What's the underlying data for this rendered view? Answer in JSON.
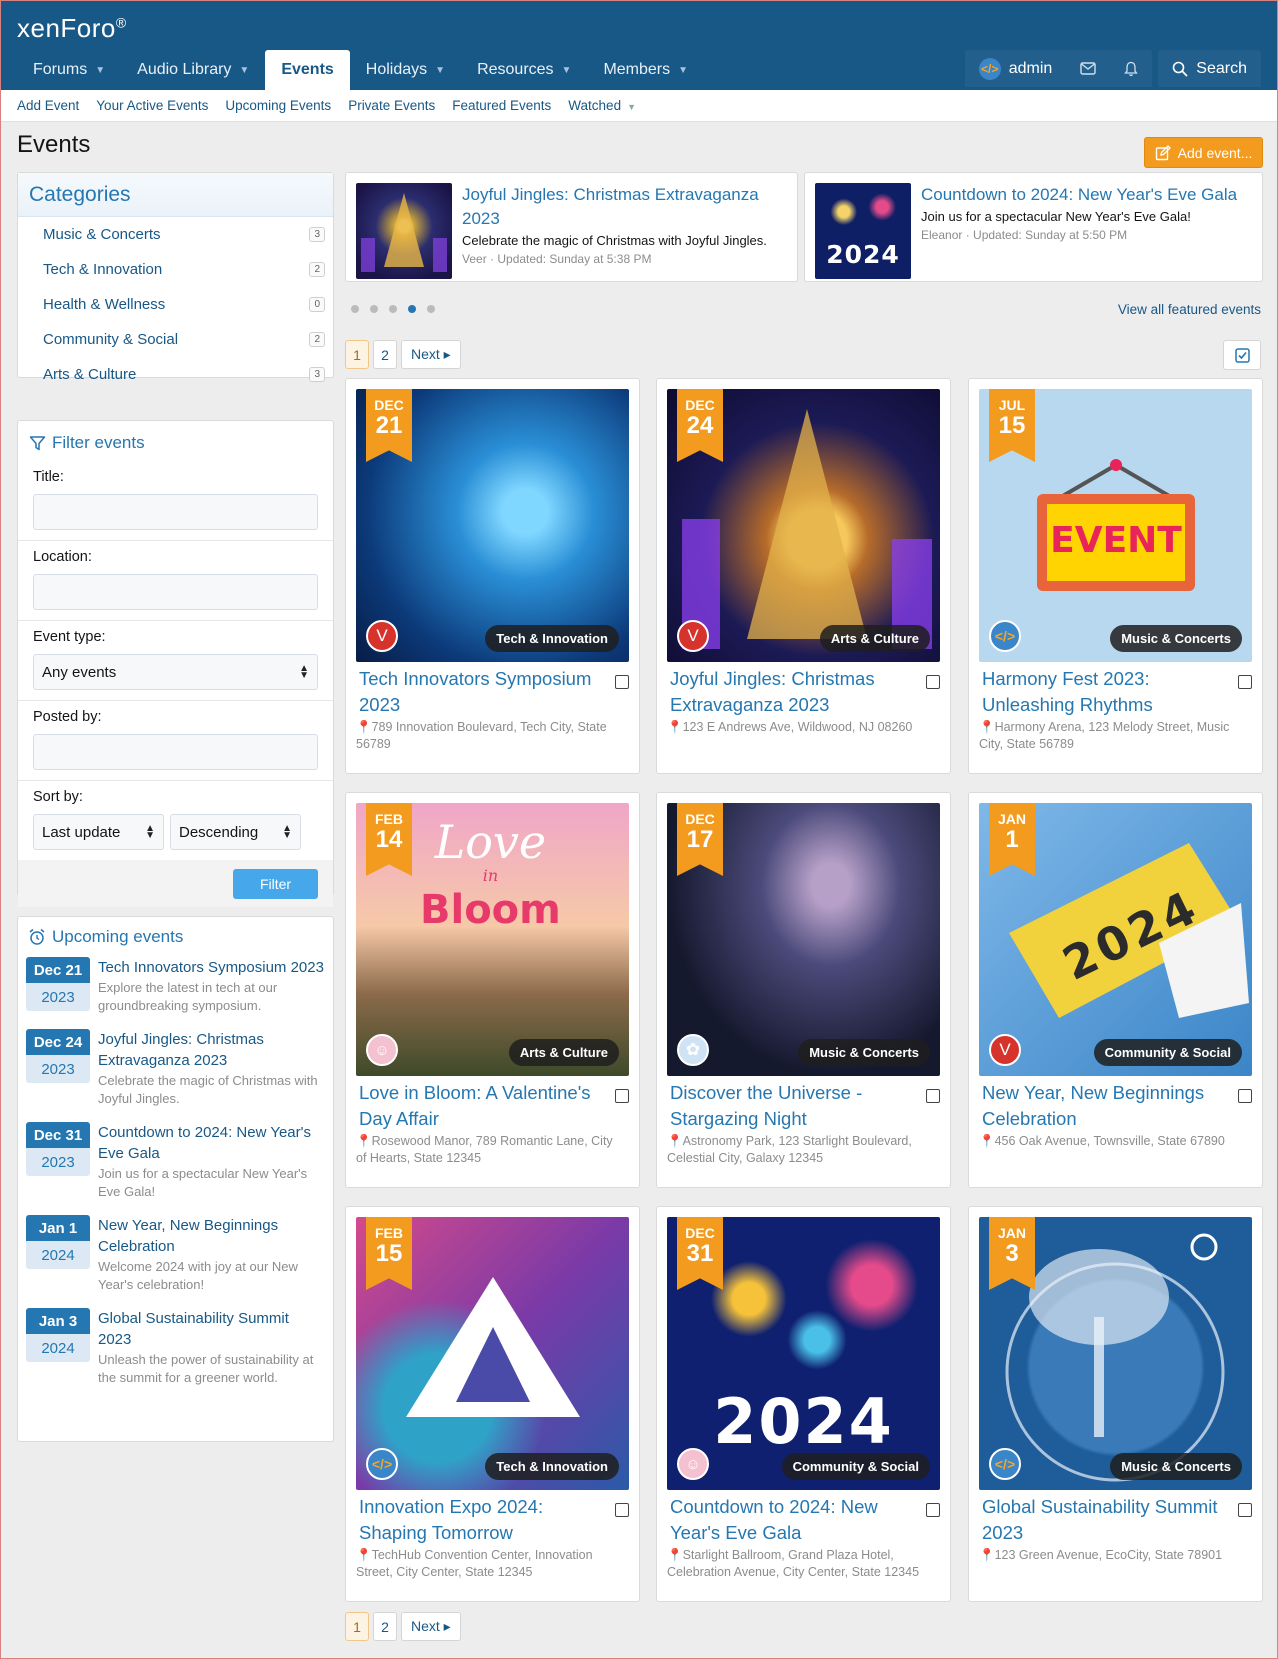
{
  "header": {
    "logo_text": "xenForo",
    "nav": [
      {
        "label": "Forums",
        "caret": true
      },
      {
        "label": "Audio Library",
        "caret": true
      },
      {
        "label": "Events",
        "caret": false,
        "active": true
      },
      {
        "label": "Holidays",
        "caret": true
      },
      {
        "label": "Resources",
        "caret": true
      },
      {
        "label": "Members",
        "caret": true
      }
    ],
    "user": "admin",
    "search_label": "Search"
  },
  "subnav": [
    "Add Event",
    "Your Active Events",
    "Upcoming Events",
    "Private Events",
    "Featured Events",
    "Watched"
  ],
  "page": {
    "title": "Events",
    "add_event_label": "Add event..."
  },
  "categories": {
    "title": "Categories",
    "items": [
      {
        "name": "Music & Concerts",
        "count": "3"
      },
      {
        "name": "Tech & Innovation",
        "count": "2"
      },
      {
        "name": "Health & Wellness",
        "count": "0"
      },
      {
        "name": "Community & Social",
        "count": "2"
      },
      {
        "name": "Arts & Culture",
        "count": "3"
      }
    ]
  },
  "filter": {
    "title": "Filter events",
    "title_label": "Title:",
    "location_label": "Location:",
    "event_type_label": "Event type:",
    "event_type_value": "Any events",
    "posted_by_label": "Posted by:",
    "sort_by_label": "Sort by:",
    "sort_value": "Last update",
    "order_value": "Descending",
    "button_label": "Filter"
  },
  "upcoming": {
    "title": "Upcoming events",
    "items": [
      {
        "date": "Dec 21",
        "year": "2023",
        "title": "Tech Innovators Symposium 2023",
        "desc": "Explore the latest in tech at our groundbreaking symposium."
      },
      {
        "date": "Dec 24",
        "year": "2023",
        "title": "Joyful Jingles: Christmas Extravaganza 2023",
        "desc": "Celebrate the magic of Christmas with Joyful Jingles."
      },
      {
        "date": "Dec 31",
        "year": "2023",
        "title": "Countdown to 2024: New Year's Eve Gala",
        "desc": "Join us for a spectacular New Year's Eve Gala!"
      },
      {
        "date": "Jan 1",
        "year": "2024",
        "title": "New Year, New Beginnings Celebration",
        "desc": "Welcome 2024 with joy at our New Year's celebration!"
      },
      {
        "date": "Jan 3",
        "year": "2024",
        "title": "Global Sustainability Summit 2023",
        "desc": "Unleash the power of sustainability at the summit for a greener world."
      }
    ]
  },
  "featured": [
    {
      "title": "Joyful Jingles: Christmas Extravaganza 2023",
      "desc": "Celebrate the magic of Christmas with Joyful Jingles.",
      "meta": "Veer · Updated: Sunday at 5:38 PM"
    },
    {
      "title": "Countdown to 2024: New Year's Eve Gala",
      "desc": "Join us for a spectacular New Year's Eve Gala!",
      "meta": "Eleanor · Updated: Sunday at 5:50 PM",
      "image_text": "2024"
    }
  ],
  "view_all_featured": "View all featured events",
  "pager": {
    "page1": "1",
    "page2": "2",
    "next": "Next ▸"
  },
  "cards": [
    {
      "month": "DEC",
      "day": "21",
      "category": "Tech & Innovation",
      "title": "Tech Innovators Symposium 2023",
      "location": "789 Innovation Boulevard, Tech City, State 56789",
      "avatar": "V"
    },
    {
      "month": "DEC",
      "day": "24",
      "category": "Arts & Culture",
      "title": "Joyful Jingles: Christmas Extravaganza 2023",
      "location": "123 E Andrews Ave, Wildwood, NJ 08260",
      "avatar": "V"
    },
    {
      "month": "JUL",
      "day": "15",
      "category": "Music & Concerts",
      "title": "Harmony Fest 2023: Unleashing Rhythms",
      "location": "Harmony Arena, 123 Melody Street, Music City, State 56789",
      "avatar": "</>",
      "image_text": "EVENT"
    },
    {
      "month": "FEB",
      "day": "14",
      "category": "Arts & Culture",
      "title": "Love in Bloom: A Valentine's Day Affair",
      "location": "Rosewood Manor, 789 Romantic Lane, City of Hearts, State 12345",
      "avatar": "☺",
      "image_text_1": "Love",
      "image_text_2": "in",
      "image_text_3": "Bloom"
    },
    {
      "month": "DEC",
      "day": "17",
      "category": "Music & Concerts",
      "title": "Discover the Universe - Stargazing Night",
      "location": "Astronomy Park, 123 Starlight Boulevard, Celestial City, Galaxy 12345",
      "avatar": "✿"
    },
    {
      "month": "JAN",
      "day": "1",
      "category": "Community & Social",
      "title": "New Year, New Beginnings Celebration",
      "location": "456 Oak Avenue, Townsville, State 67890",
      "avatar": "V",
      "image_text": "2024"
    },
    {
      "month": "FEB",
      "day": "15",
      "category": "Tech & Innovation",
      "title": "Innovation Expo 2024: Shaping Tomorrow",
      "location": "TechHub Convention Center, Innovation Street, City Center, State 12345",
      "avatar": "</>"
    },
    {
      "month": "DEC",
      "day": "31",
      "category": "Community & Social",
      "title": "Countdown to 2024: New Year's Eve Gala",
      "location": "Starlight Ballroom, Grand Plaza Hotel, Celebration Avenue, City Center, State 12345",
      "avatar": "☺",
      "image_text": "2024"
    },
    {
      "month": "JAN",
      "day": "3",
      "category": "Music & Concerts",
      "title": "Global Sustainability Summit 2023",
      "location": "123 Green Avenue, EcoCity, State 78901",
      "avatar": "</>"
    }
  ]
}
